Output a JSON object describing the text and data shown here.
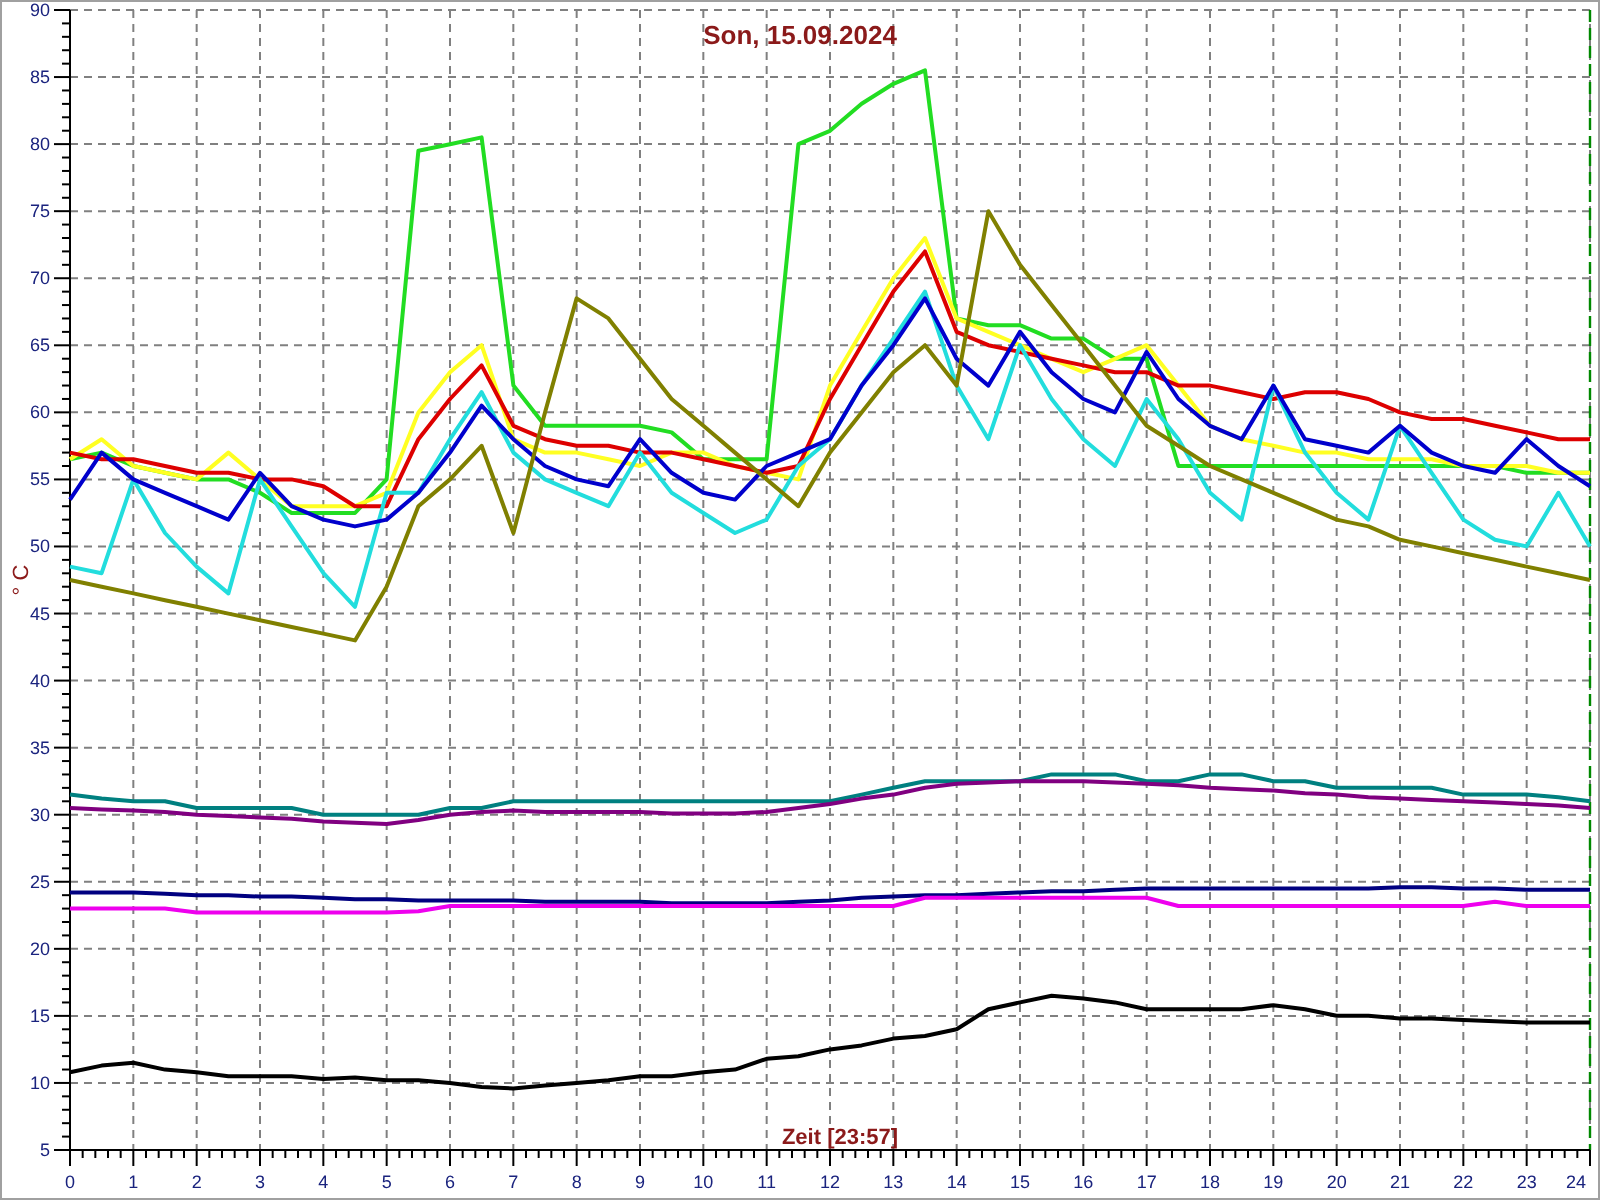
{
  "chart": {
    "chart_data": {
      "type": "line",
      "title": "Son, 15.09.2024",
      "xlabel": "Zeit [23:57]",
      "ylabel": "° C",
      "x": [
        0,
        0.5,
        1,
        1.5,
        2,
        2.5,
        3,
        3.5,
        4,
        4.5,
        5,
        5.5,
        6,
        6.5,
        7,
        7.5,
        8,
        8.5,
        9,
        9.5,
        10,
        10.5,
        11,
        11.5,
        12,
        12.5,
        13,
        13.5,
        14,
        14.5,
        15,
        15.5,
        16,
        16.5,
        17,
        17.5,
        18,
        18.5,
        19,
        19.5,
        20,
        20.5,
        21,
        21.5,
        22,
        22.5,
        23,
        23.5,
        24
      ],
      "grid": true,
      "xlim": [
        0,
        24
      ],
      "ylim": [
        5,
        90
      ],
      "xticks": [
        0,
        1,
        2,
        3,
        4,
        5,
        6,
        7,
        8,
        9,
        10,
        11,
        12,
        13,
        14,
        15,
        16,
        17,
        18,
        19,
        20,
        21,
        22,
        23,
        24
      ],
      "yticks": [
        5,
        10,
        15,
        20,
        25,
        30,
        35,
        40,
        45,
        50,
        55,
        60,
        65,
        70,
        75,
        80,
        85,
        90
      ],
      "series": [
        {
          "color": "#22dd22",
          "values": [
            56.5,
            57,
            56,
            55.5,
            55,
            55,
            54,
            52.5,
            52.5,
            52.5,
            55,
            79.5,
            80,
            80.5,
            62,
            59,
            59,
            59,
            59,
            58.5,
            56.5,
            56.5,
            56.5,
            80,
            81,
            83,
            84.5,
            85.5,
            67,
            66.5,
            66.5,
            65.5,
            65.5,
            64,
            64,
            56,
            56,
            56,
            56,
            56,
            56,
            56,
            56,
            56,
            56,
            56,
            55.5,
            55.5,
            55.5
          ]
        },
        {
          "color": "#ffff22",
          "values": [
            56.5,
            58,
            56,
            55.5,
            55,
            57,
            55,
            53,
            53,
            53,
            54,
            60,
            63,
            65,
            58,
            57,
            57,
            56.5,
            56,
            57,
            57,
            56,
            55.5,
            55,
            62,
            66,
            70,
            73,
            67,
            66,
            65,
            64,
            63,
            64,
            65,
            62,
            59,
            58,
            57.5,
            57,
            57,
            56.5,
            56.5,
            56.5,
            56,
            56,
            56,
            55.5,
            55.5
          ]
        },
        {
          "color": "#dd0000",
          "values": [
            57,
            56.5,
            56.5,
            56,
            55.5,
            55.5,
            55,
            55,
            54.5,
            53,
            53,
            58,
            61,
            63.5,
            59,
            58,
            57.5,
            57.5,
            57,
            57,
            56.5,
            56,
            55.5,
            56,
            61,
            65,
            69,
            72,
            66,
            65,
            64.5,
            64,
            63.5,
            63,
            63,
            62,
            62,
            61.5,
            61,
            61.5,
            61.5,
            61,
            60,
            59.5,
            59.5,
            59,
            58.5,
            58,
            58
          ]
        },
        {
          "color": "#22dddd",
          "values": [
            48.5,
            48,
            55,
            51,
            48.5,
            46.5,
            55,
            51.5,
            48,
            45.5,
            54,
            54,
            58,
            61.5,
            57,
            55,
            54,
            53,
            57,
            54,
            52.5,
            51,
            52,
            56,
            58,
            62,
            65.5,
            69,
            62,
            58,
            65,
            61,
            58,
            56,
            61,
            58,
            54,
            52,
            62,
            57,
            54,
            52,
            59,
            55.5,
            52,
            50.5,
            50,
            54,
            50
          ]
        },
        {
          "color": "#0000cc",
          "values": [
            53.5,
            57,
            55,
            54,
            53,
            52,
            55.5,
            53,
            52,
            51.5,
            52,
            54,
            57,
            60.5,
            58,
            56,
            55,
            54.5,
            58,
            55.5,
            54,
            53.5,
            56,
            57,
            58,
            62,
            65,
            68.5,
            64,
            62,
            66,
            63,
            61,
            60,
            64.5,
            61,
            59,
            58,
            62,
            58,
            57.5,
            57,
            59,
            57,
            56,
            55.5,
            58,
            56,
            54.5
          ]
        },
        {
          "color": "#808000",
          "values": [
            47.5,
            47,
            46.5,
            46,
            45.5,
            45,
            44.5,
            44,
            43.5,
            43,
            47,
            53,
            55,
            57.5,
            51,
            60,
            68.5,
            67,
            64,
            61,
            59,
            57,
            55,
            53,
            57,
            60,
            63,
            65,
            62,
            75,
            71,
            68,
            65,
            62,
            59,
            57.5,
            56,
            55,
            54,
            53,
            52,
            51.5,
            50.5,
            50,
            49.5,
            49,
            48.5,
            48,
            47.5
          ]
        },
        {
          "color": "#008080",
          "values": [
            31.5,
            31.2,
            31,
            31,
            30.5,
            30.5,
            30.5,
            30.5,
            30,
            30,
            30,
            30,
            30.5,
            30.5,
            31,
            31,
            31,
            31,
            31,
            31,
            31,
            31,
            31,
            31,
            31,
            31.5,
            32,
            32.5,
            32.5,
            32.5,
            32.5,
            33,
            33,
            33,
            32.5,
            32.5,
            33,
            33,
            32.5,
            32.5,
            32,
            32,
            32,
            32,
            31.5,
            31.5,
            31.5,
            31.3,
            31
          ]
        },
        {
          "color": "#800080",
          "values": [
            30.5,
            30.4,
            30.3,
            30.2,
            30,
            29.9,
            29.8,
            29.7,
            29.5,
            29.4,
            29.3,
            29.6,
            30,
            30.2,
            30.3,
            30.2,
            30.2,
            30.2,
            30.2,
            30.1,
            30.1,
            30.1,
            30.2,
            30.5,
            30.8,
            31.2,
            31.5,
            32,
            32.3,
            32.4,
            32.5,
            32.5,
            32.5,
            32.4,
            32.3,
            32.2,
            32,
            31.9,
            31.8,
            31.6,
            31.5,
            31.3,
            31.2,
            31.1,
            31,
            30.9,
            30.8,
            30.7,
            30.5
          ]
        },
        {
          "color": "#000080",
          "values": [
            24.2,
            24.2,
            24.2,
            24.1,
            24,
            24,
            23.9,
            23.9,
            23.8,
            23.7,
            23.7,
            23.6,
            23.6,
            23.6,
            23.6,
            23.5,
            23.5,
            23.5,
            23.5,
            23.4,
            23.4,
            23.4,
            23.4,
            23.5,
            23.6,
            23.8,
            23.9,
            24,
            24,
            24.1,
            24.2,
            24.3,
            24.3,
            24.4,
            24.5,
            24.5,
            24.5,
            24.5,
            24.5,
            24.5,
            24.5,
            24.5,
            24.6,
            24.6,
            24.5,
            24.5,
            24.4,
            24.4,
            24.4
          ]
        },
        {
          "color": "#ee00ee",
          "values": [
            23,
            23,
            23,
            23,
            22.7,
            22.7,
            22.7,
            22.7,
            22.7,
            22.7,
            22.7,
            22.8,
            23.2,
            23.2,
            23.2,
            23.2,
            23.2,
            23.2,
            23.2,
            23.2,
            23.2,
            23.2,
            23.2,
            23.2,
            23.2,
            23.2,
            23.2,
            23.8,
            23.8,
            23.8,
            23.8,
            23.8,
            23.8,
            23.8,
            23.8,
            23.2,
            23.2,
            23.2,
            23.2,
            23.2,
            23.2,
            23.2,
            23.2,
            23.2,
            23.2,
            23.5,
            23.2,
            23.2,
            23.2
          ]
        },
        {
          "color": "#000000",
          "values": [
            10.8,
            11.3,
            11.5,
            11,
            10.8,
            10.5,
            10.5,
            10.5,
            10.3,
            10.4,
            10.2,
            10.2,
            10,
            9.7,
            9.6,
            9.8,
            10,
            10.2,
            10.5,
            10.5,
            10.8,
            11,
            11.8,
            12,
            12.5,
            12.8,
            13.3,
            13.5,
            14,
            15.5,
            16,
            16.5,
            16.3,
            16,
            15.5,
            15.5,
            15.5,
            15.5,
            15.8,
            15.5,
            15,
            15,
            14.8,
            14.8,
            14.7,
            14.6,
            14.5,
            14.5,
            14.5
          ]
        }
      ]
    }
  }
}
